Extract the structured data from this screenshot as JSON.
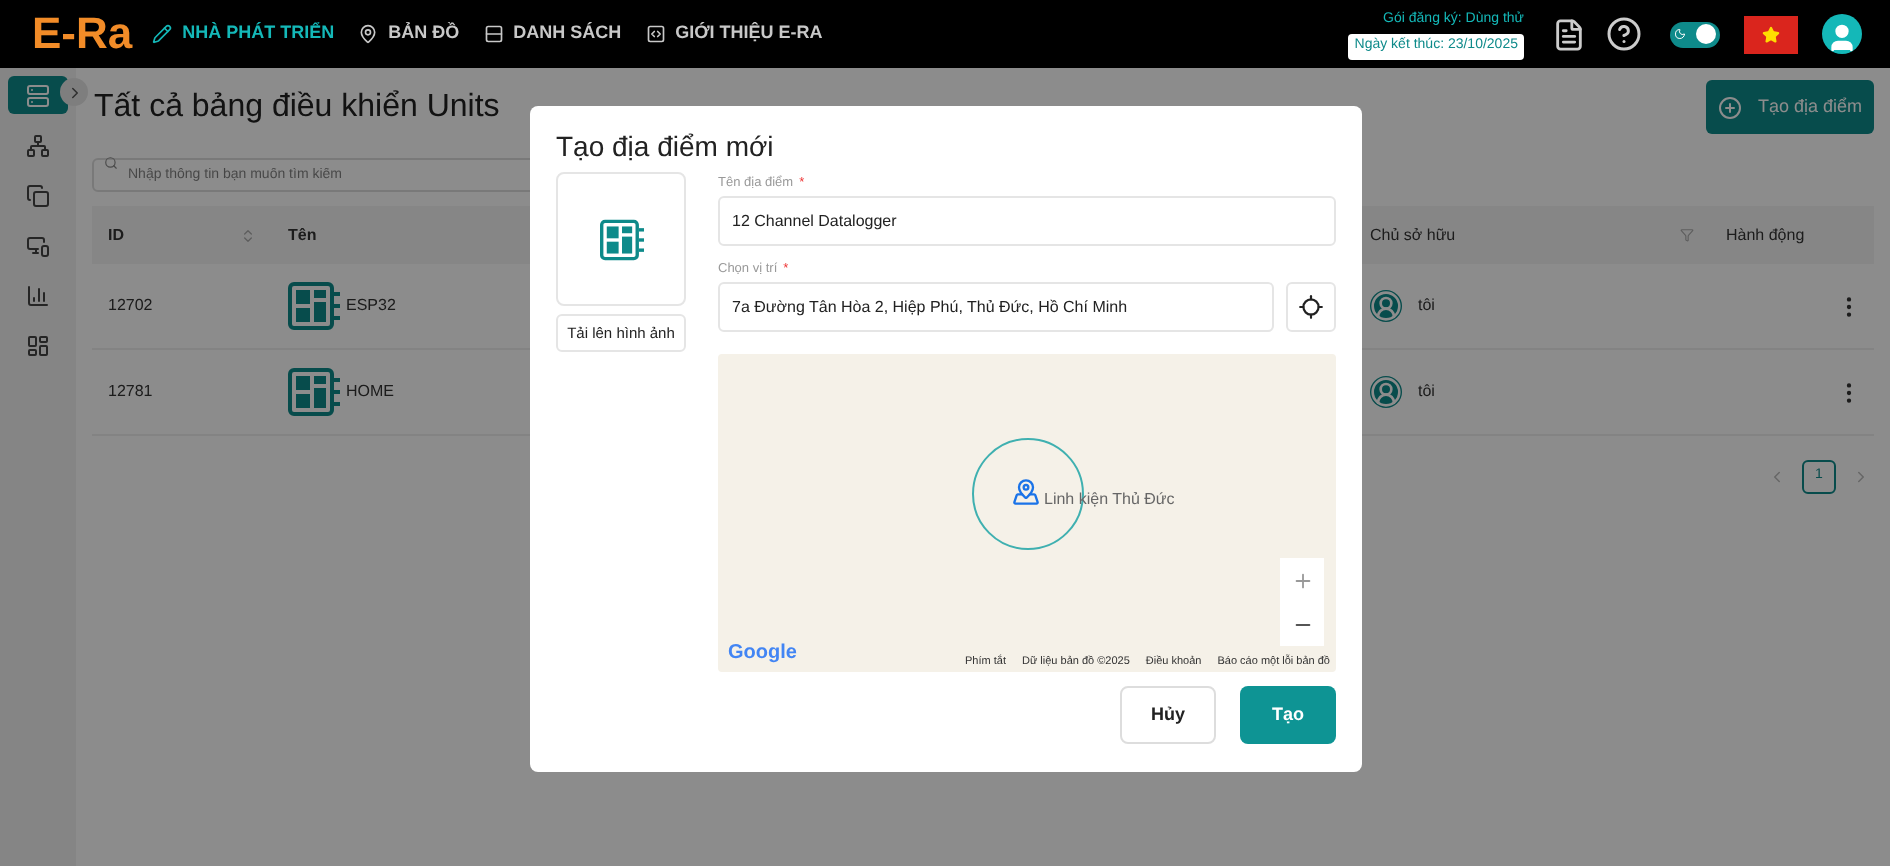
{
  "header": {
    "logo": "E-Ra",
    "nav": [
      {
        "label": "NHÀ PHÁT TRIỂN",
        "kind": "pencil",
        "selected": true
      },
      {
        "label": "BẢN ĐỒ",
        "kind": "pin",
        "selected": false
      },
      {
        "label": "DANH SÁCH",
        "kind": "list",
        "selected": false
      },
      {
        "label": "GIỚI THIỆU E-RA",
        "kind": "info",
        "selected": false
      }
    ],
    "subscription": "Gói đăng ký: Dùng thử",
    "end_date": "Ngày kết thúc: 23/10/2025",
    "theme_toggle": {
      "on": true
    }
  },
  "sidebar": {
    "items": [
      {
        "kind": "list",
        "selected": true
      },
      {
        "kind": "tree",
        "selected": false
      },
      {
        "kind": "copy",
        "selected": false
      },
      {
        "kind": "devices",
        "selected": false
      },
      {
        "kind": "chart",
        "selected": false
      },
      {
        "kind": "dashboard",
        "selected": false
      }
    ]
  },
  "page": {
    "title": "Tất cả bảng điều khiển Units",
    "create_button": "Tạo địa điểm",
    "search": {
      "placeholder": "Nhập thông tin bạn muốn tìm kiếm"
    },
    "table": {
      "columns": [
        "ID",
        "Tên",
        "Chủ sở hữu",
        "Hành động"
      ],
      "rows": [
        {
          "id": "12702",
          "name": "ESP32",
          "owner": "tôi"
        },
        {
          "id": "12781",
          "name": "HOME",
          "owner": "tôi"
        }
      ]
    },
    "pagination": [
      {
        "label": "1",
        "selected": true
      }
    ]
  },
  "modal": {
    "title": "Tạo địa điểm mới",
    "upload_button": "Tải lên hình ảnh",
    "name_field": {
      "label": "Tên địa điểm",
      "required_mark": "*",
      "value": "12 Channel Datalogger"
    },
    "location_field": {
      "label": "Chọn vị trí",
      "required_mark": "*",
      "value": "7a Đường Tân Hòa 2, Hiệp Phú, Thủ Đức, Hồ Chí Minh"
    },
    "map": {
      "marker_label": "Linh kiện Thủ Đức",
      "logo": "Google",
      "attribution": [
        "Phím tắt",
        "Dữ liệu bản đồ ©2025",
        "Điều khoản",
        "Báo cáo một lỗi bản đồ"
      ]
    },
    "buttons": [
      {
        "label": "Hủy",
        "kind": "secondary"
      },
      {
        "label": "Tạo",
        "kind": "primary"
      }
    ]
  }
}
